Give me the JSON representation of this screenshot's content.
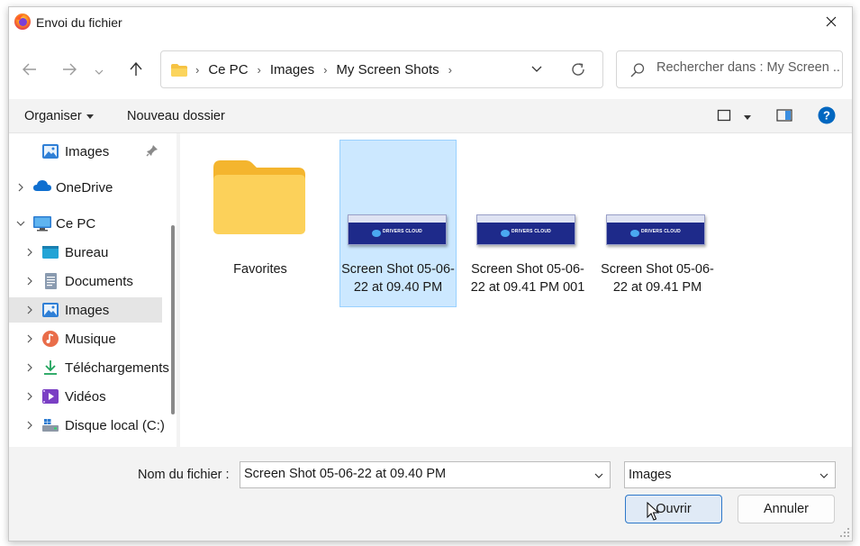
{
  "window": {
    "title": "Envoi du fichier",
    "app_icon": "firefox-icon"
  },
  "nav": {
    "breadcrumb": [
      "Ce PC",
      "Images",
      "My Screen Shots"
    ],
    "search_placeholder": "Rechercher dans : My Screen ..."
  },
  "toolbar": {
    "organize_label": "Organiser",
    "new_folder_label": "Nouveau dossier"
  },
  "sidebar": {
    "items": [
      {
        "label": "Images",
        "icon": "images-icon",
        "pinned": true
      },
      {
        "label": "OneDrive",
        "icon": "onedrive-icon"
      },
      {
        "label": "Ce PC",
        "icon": "computer-icon",
        "expanded": true
      },
      {
        "label": "Bureau",
        "icon": "desktop-icon"
      },
      {
        "label": "Documents",
        "icon": "documents-icon"
      },
      {
        "label": "Images",
        "icon": "images-icon",
        "selected": true
      },
      {
        "label": "Musique",
        "icon": "music-icon"
      },
      {
        "label": "Téléchargements",
        "icon": "downloads-icon"
      },
      {
        "label": "Vidéos",
        "icon": "videos-icon"
      },
      {
        "label": "Disque local (C:)",
        "icon": "drive-icon"
      }
    ]
  },
  "files": [
    {
      "type": "folder",
      "name": "Favorites"
    },
    {
      "type": "image",
      "name": "Screen Shot 05-06-22 at 09.40 PM",
      "selected": true,
      "thumb_text": "DRIVERS CLOUD"
    },
    {
      "type": "image",
      "name": "Screen Shot 05-06-22 at 09.41 PM 001",
      "thumb_text": "DRIVERS CLOUD"
    },
    {
      "type": "image",
      "name": "Screen Shot 05-06-22 at 09.41 PM",
      "thumb_text": "DRIVERS CLOUD"
    }
  ],
  "footer": {
    "filename_label": "Nom du fichier :",
    "filename_value": "Screen Shot 05-06-22 at 09.40 PM",
    "filetype_value": "Images",
    "open_label": "Ouvrir",
    "cancel_label": "Annuler"
  },
  "colors": {
    "accent": "#0067c0",
    "selection_bg": "#cce8ff",
    "selection_border": "#99d1ff",
    "folder_yellow": "#f8c84a",
    "thumb_navy": "#1e2a8a"
  }
}
